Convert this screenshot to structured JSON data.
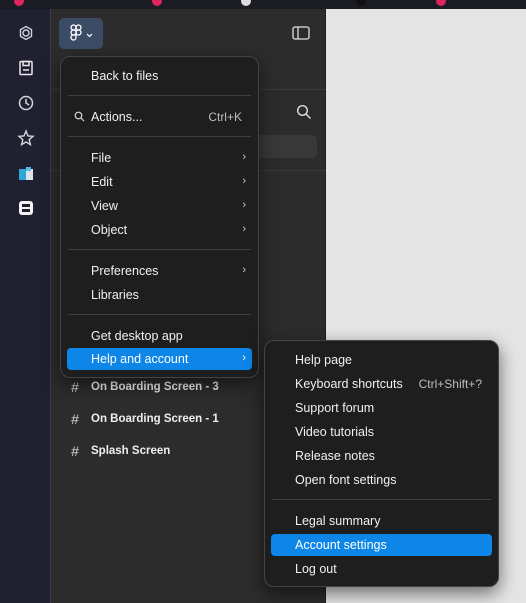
{
  "colors": {
    "accent": "#0d86e8",
    "menu_bg": "#1e1e1e",
    "panel_bg": "#2c2c2c",
    "rail_bg": "#202030",
    "canvas_bg": "#e5e5e5",
    "logo_button_bg": "#3d4c66"
  },
  "rail": {
    "icons": [
      "chatgpt-icon",
      "save-icon",
      "history-icon",
      "star-icon",
      "flipboard-icon",
      "app-icon"
    ]
  },
  "main_menu": {
    "back": "Back to files",
    "actions": "Actions...",
    "actions_shortcut": "Ctrl+K",
    "file": "File",
    "edit": "Edit",
    "view": "View",
    "object": "Object",
    "preferences": "Preferences",
    "libraries": "Libraries",
    "get_desktop": "Get desktop app",
    "help": "Help and account"
  },
  "help_menu": {
    "help_page": "Help page",
    "keyboard_shortcuts": "Keyboard shortcuts",
    "keyboard_shortcuts_key": "Ctrl+Shift+?",
    "support_forum": "Support forum",
    "video_tutorials": "Video tutorials",
    "release_notes": "Release notes",
    "open_font_settings": "Open font settings",
    "legal_summary": "Legal summary",
    "account_settings": "Account settings",
    "log_out": "Log out"
  },
  "frames": [
    "On Boarding Screen - 3",
    "On Boarding Screen - 1",
    "Splash Screen"
  ]
}
